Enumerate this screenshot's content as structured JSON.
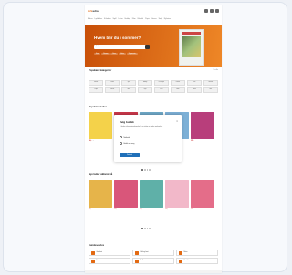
{
  "brand": {
    "logo_left": "Ark",
    "logo_right": "adia",
    "accent": "#e36a12"
  },
  "nav": [
    "Bøker",
    "Lydbøker",
    "E-bøker",
    "Spill",
    "Leker",
    "Hobby",
    "Film",
    "Musikk",
    "Papir",
    "Gaver",
    "Salg",
    "Nyheter"
  ],
  "hero": {
    "title": "Hvem blir du i sommer?",
    "search_placeholder": "Søk",
    "pills": [
      "Krim",
      "Roman",
      "Barn",
      "Fakta",
      "Tegneserie"
    ]
  },
  "categories": {
    "title": "Populære kategorier",
    "link": "Se alle",
    "items": [
      "Bøker",
      "Leker",
      "Spill",
      "Hobby",
      "Puslespill",
      "Kontor",
      "Film",
      "Musikk",
      "Papir",
      "Gaver",
      "Tilbud",
      "Nytt",
      "Krim",
      "Barn",
      "Fakta",
      "Mer"
    ]
  },
  "section1": {
    "title": "Populære bøker",
    "products": [
      {
        "title": "Lykkelig",
        "price": "199,-",
        "color": "#f4d24a"
      },
      {
        "title": "Kom hjem",
        "price": "249,-",
        "color": "#c9374a"
      },
      {
        "title": "Sommer",
        "price": "179,-",
        "color": "#6fa8c7"
      },
      {
        "title": "Stallen",
        "price": "299,-",
        "color": "#7db0d6"
      },
      {
        "title": "Klokka",
        "price": "229,-",
        "color": "#b83e7b"
      }
    ]
  },
  "section2": {
    "title": "Nye bøker akkurat nå",
    "products": [
      {
        "title": "Skogen",
        "price": "199,-",
        "color": "#e6b44a"
      },
      {
        "title": "Elva",
        "price": "249,-",
        "color": "#d9567a"
      },
      {
        "title": "Fjellet",
        "price": "179,-",
        "color": "#5fb0a8"
      },
      {
        "title": "Himmel",
        "price": "219,-",
        "color": "#f2b8c9"
      },
      {
        "title": "Byen",
        "price": "269,-",
        "color": "#e46d89"
      }
    ]
  },
  "modal": {
    "title": "Velg butikk",
    "text": "Vi bruker informasjonskapsler for å gi deg en bedre opplevelse.",
    "options": [
      "Nettbutikk",
      "Butikk nær meg"
    ],
    "button": "Fortsett"
  },
  "services": {
    "title": "Kundeservice",
    "items": [
      "Gavekort",
      "Klikk og hent",
      "Retur",
      "Frakt",
      "Medlem",
      "Kontakt"
    ]
  }
}
